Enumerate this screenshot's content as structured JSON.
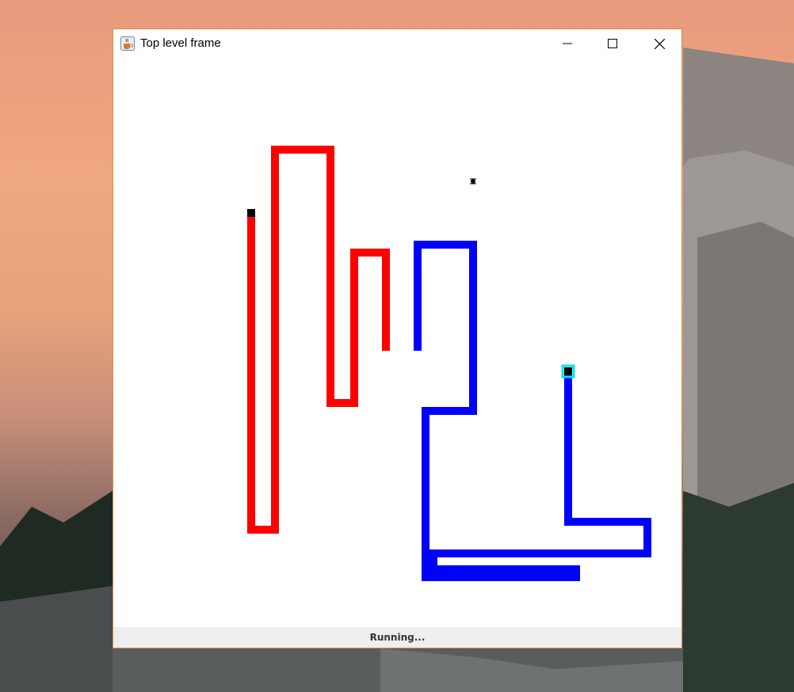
{
  "window": {
    "title": "Top level frame",
    "app_icon": "java-cup-icon"
  },
  "controls": {
    "minimize": "minimize-icon",
    "maximize": "maximize-icon",
    "close": "close-icon"
  },
  "game": {
    "colors": {
      "player1": "#ff0000",
      "player2": "#0000ff",
      "head": "#000000",
      "highlight": "#00e5e5"
    }
  },
  "status": {
    "text": "Running..."
  }
}
